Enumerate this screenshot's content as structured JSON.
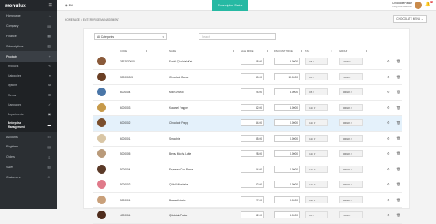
{
  "brand": "menulux",
  "language": "EN",
  "subscription_status": "Subscription Status",
  "user": {
    "name": "Chocolate Palace",
    "email": "info@chocolate.com"
  },
  "notifications": "1",
  "breadcrumb": "HOMEPAGE > ENTERPRISE MANAGEMENT",
  "chocolate_menu": "CHOCOLATE MENU ⌄",
  "sidebar": [
    {
      "label": "Homepage",
      "icon": "⌂"
    },
    {
      "label": "Company",
      "icon": "▤"
    },
    {
      "label": "Finance",
      "icon": "▦"
    },
    {
      "label": "Subscriptions",
      "icon": "▥"
    }
  ],
  "products_label": "Products",
  "products_icon": "+",
  "submenu": [
    {
      "label": "Products",
      "icon": "✎"
    },
    {
      "label": "Categories",
      "icon": "≡"
    },
    {
      "label": "Options",
      "icon": "⚙"
    },
    {
      "label": "Menus",
      "icon": "☰"
    },
    {
      "label": "Campaigns",
      "icon": "✓"
    },
    {
      "label": "Departments",
      "icon": "▣"
    }
  ],
  "submenu_current": "Enterprise Management",
  "sidebar_bottom": [
    {
      "label": "Accounts",
      "icon": "☷"
    },
    {
      "label": "Registers",
      "icon": "▤"
    },
    {
      "label": "Orders",
      "icon": "⇩"
    },
    {
      "label": "Sales",
      "icon": "▥"
    },
    {
      "label": "Customers",
      "icon": "☺"
    }
  ],
  "filter": {
    "category": "All Categories",
    "search_placeholder": "Search"
  },
  "columns": {
    "code": "CODE",
    "name": "NAME",
    "sale_price": "SALE PRICE",
    "discount": "DISCOUNT PRICE",
    "tax": "TAX",
    "group": "GROUP"
  },
  "products": [
    {
      "code": "3562870000",
      "name": "Fındık Çikolatalı Kek",
      "price": "28.00",
      "discount": "5.0000",
      "tax": "%5",
      "group": "FOOD",
      "img": "#8a5a3a"
    },
    {
      "code": "300000003",
      "name": "Chocolate Brown",
      "price": "40.00",
      "discount": "10.0000",
      "tax": "%5",
      "group": "FOOD",
      "img": "#6b3f24"
    },
    {
      "code": "6000004",
      "name": "MILKSHAKE",
      "price": "24.00",
      "discount": "5.0000",
      "tax": "%5",
      "group": "DRINK",
      "img": "#4a76a8"
    },
    {
      "code": "6000003",
      "name": "Karamel Frappe",
      "price": "32.00",
      "discount": "6.0000",
      "tax": "%10",
      "group": "DRINK",
      "img": "#c79a4a"
    },
    {
      "code": "6000002",
      "name": "Chocolate Frapp",
      "price": "34.00",
      "discount": "0.0000",
      "tax": "%10",
      "group": "DRINK",
      "img": "#7a4e2c"
    },
    {
      "code": "6000001",
      "name": "Smoothie",
      "price": "35.00",
      "discount": "0.0000",
      "tax": "%10",
      "group": "DRINK",
      "img": "#d9c6a5"
    },
    {
      "code": "5000005",
      "name": "Beyaz Mocha Latte",
      "price": "28.00",
      "discount": "0.0000",
      "tax": "%10",
      "group": "DRINK",
      "img": "#b99a7a"
    },
    {
      "code": "5000004",
      "name": "Espresso Con Panna",
      "price": "24.00",
      "discount": "0.0000",
      "tax": "%10",
      "group": "DRINK",
      "img": "#5b3a28"
    },
    {
      "code": "5000002",
      "name": "Çilekli Milkshake",
      "price": "32.00",
      "discount": "0.0000",
      "tax": "%10",
      "group": "DRINK",
      "img": "#e07a8a"
    },
    {
      "code": "5000001",
      "name": "Baharatlı Latte",
      "price": "27.00",
      "discount": "0.0000",
      "tax": "%10",
      "group": "DRINK",
      "img": "#c9a07a"
    },
    {
      "code": "4000004",
      "name": "Çikolatalı Pasta",
      "price": "32.00",
      "discount": "5.0000",
      "tax": "%5",
      "group": "FOOD",
      "img": "#4e2c1c"
    }
  ],
  "icons": {
    "gear": "⚙",
    "trash": "🗑",
    "sort": "⇕"
  }
}
